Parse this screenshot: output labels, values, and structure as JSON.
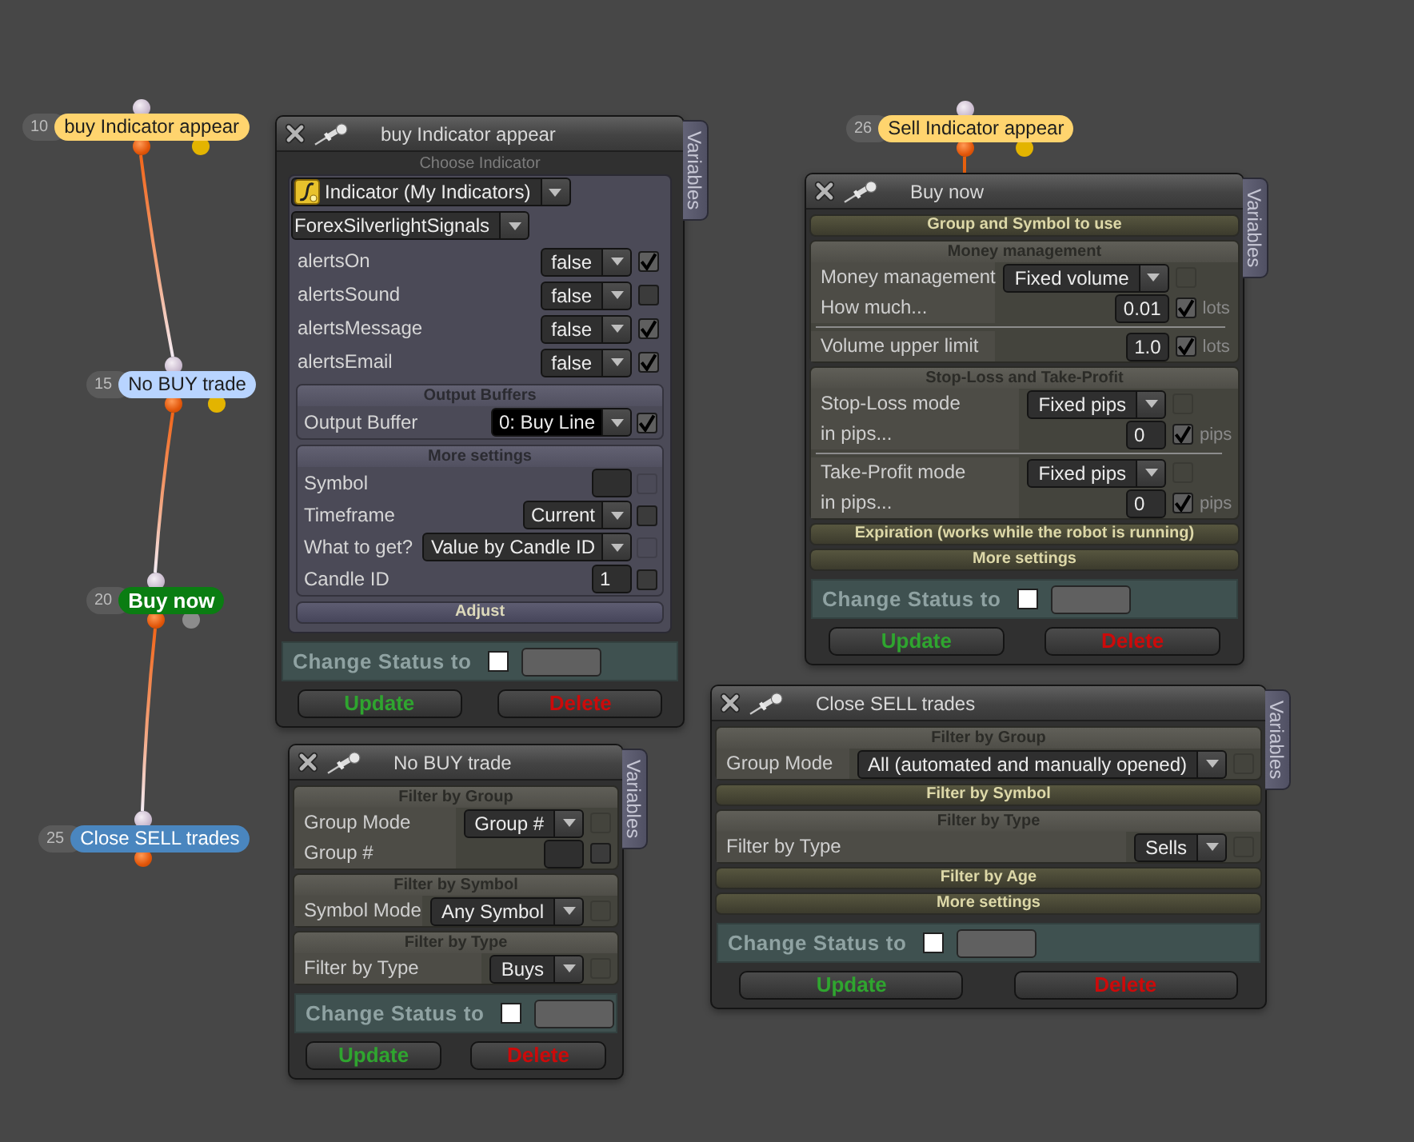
{
  "nodes": [
    {
      "number": "10",
      "label": "buy Indicator appear",
      "color": "#ffd46e",
      "side_pin": {
        "color": "#e3b400"
      },
      "selected": false
    },
    {
      "number": "15",
      "label": "No BUY trade",
      "color": "#b8d4ff",
      "side_pin": {
        "color": "#e3b400"
      },
      "selected": false
    },
    {
      "number": "20",
      "label": "Buy now",
      "color": "#0a7d12",
      "side_pin": {
        "color": "#8c8c8c"
      },
      "selected": true
    },
    {
      "number": "25",
      "label": "Close SELL trades",
      "color": "#4a86bf",
      "selected": false
    },
    {
      "number": "26",
      "label": "Sell Indicator appear",
      "color": "#ffd46e",
      "side_pin": {
        "color": "#e3b400"
      },
      "selected": false
    }
  ],
  "windows": [
    {
      "title": "buy Indicator appear",
      "side_tab": "Variables",
      "blocks": [
        {
          "kind": "caption",
          "text": "Choose Indicator"
        },
        {
          "kind": "panel",
          "rows": [
            {
              "kind": "indicator",
              "value": "Indicator (My Indicators)"
            },
            {
              "kind": "picker",
              "value": "ForexSilverlightSignals"
            },
            {
              "kind": "select",
              "label": "alertsOn",
              "value": "false",
              "focused": false,
              "checkbox": {
                "checked": true,
                "disabled": false
              }
            },
            {
              "kind": "select",
              "label": "alertsSound",
              "value": "false",
              "focused": false,
              "checkbox": {
                "checked": false,
                "disabled": false
              }
            },
            {
              "kind": "select",
              "label": "alertsMessage",
              "value": "false",
              "focused": false,
              "checkbox": {
                "checked": true,
                "disabled": false
              }
            },
            {
              "kind": "select",
              "label": "alertsEmail",
              "value": "false",
              "focused": false,
              "checkbox": {
                "checked": true,
                "disabled": false
              }
            },
            {
              "kind": "section",
              "title": "Output Buffers",
              "expanded": true,
              "rows": [
                {
                  "kind": "select",
                  "label": "Output Buffer",
                  "value": "0: Buy Line",
                  "focused": true,
                  "checkbox": {
                    "checked": true,
                    "disabled": false
                  }
                }
              ]
            },
            {
              "kind": "section",
              "title": "More settings",
              "expanded": true,
              "rows": [
                {
                  "kind": "input",
                  "label": "Symbol",
                  "checkbox": {
                    "checked": false,
                    "disabled": true
                  }
                },
                {
                  "kind": "select",
                  "label": "Timeframe",
                  "value": "Current",
                  "focused": false,
                  "checkbox": {
                    "checked": false,
                    "disabled": false
                  }
                },
                {
                  "kind": "select",
                  "label": "What to get?",
                  "value": "Value by Candle ID",
                  "focused": false,
                  "checkbox": {
                    "checked": false,
                    "disabled": true
                  }
                },
                {
                  "kind": "input",
                  "label": "Candle ID",
                  "value": "1",
                  "checkbox": {
                    "checked": false,
                    "disabled": false
                  }
                }
              ]
            },
            {
              "kind": "section",
              "title": "Adjust",
              "expanded": false
            }
          ]
        }
      ],
      "status": {
        "label": "Change Status to",
        "checked": false
      },
      "buttons": [
        {
          "kind": "update",
          "label": "Update"
        },
        {
          "kind": "delete",
          "label": "Delete"
        }
      ]
    },
    {
      "title": "Buy now",
      "side_tab": "Variables",
      "blocks": [
        {
          "kind": "section",
          "title": "Group and Symbol to use",
          "expanded": false
        },
        {
          "kind": "section",
          "title": "Money management",
          "expanded": true,
          "rows": [
            {
              "kind": "select",
              "label": "Money management",
              "value": "Fixed volume",
              "focused": false,
              "checkbox": {
                "checked": false,
                "disabled": true
              }
            },
            {
              "kind": "input",
              "label": "How much...",
              "value": "0.01",
              "unit": "lots",
              "checkbox": {
                "checked": true,
                "disabled": false
              }
            },
            {
              "kind": "rule"
            },
            {
              "kind": "input",
              "label": "Volume upper limit",
              "value": "1.0",
              "unit": "lots",
              "checkbox": {
                "checked": true,
                "disabled": false
              }
            }
          ]
        },
        {
          "kind": "section",
          "title": "Stop-Loss and Take-Profit",
          "expanded": true,
          "rows": [
            {
              "kind": "select",
              "label": "Stop-Loss mode",
              "value": "Fixed pips",
              "focused": false,
              "checkbox": {
                "checked": false,
                "disabled": true
              }
            },
            {
              "kind": "input",
              "label": "in pips...",
              "value": "0",
              "unit": "pips",
              "checkbox": {
                "checked": true,
                "disabled": false
              }
            },
            {
              "kind": "rule"
            },
            {
              "kind": "select",
              "label": "Take-Profit mode",
              "value": "Fixed pips",
              "focused": false,
              "checkbox": {
                "checked": false,
                "disabled": true
              }
            },
            {
              "kind": "input",
              "label": "in pips...",
              "value": "0",
              "unit": "pips",
              "checkbox": {
                "checked": true,
                "disabled": false
              }
            }
          ]
        },
        {
          "kind": "section",
          "title": "Expiration (works while the robot is running)",
          "expanded": false
        },
        {
          "kind": "section",
          "title": "More settings",
          "expanded": false
        }
      ],
      "status": {
        "label": "Change Status to",
        "checked": false
      },
      "buttons": [
        {
          "kind": "update",
          "label": "Update"
        },
        {
          "kind": "delete",
          "label": "Delete"
        }
      ]
    },
    {
      "title": "No BUY trade",
      "side_tab": "Variables",
      "blocks": [
        {
          "kind": "section",
          "title": "Filter by Group",
          "expanded": true,
          "rows": [
            {
              "kind": "select",
              "label": "Group Mode",
              "value": "Group #",
              "focused": false,
              "checkbox": {
                "checked": false,
                "disabled": true
              }
            },
            {
              "kind": "input",
              "label": "Group #",
              "checkbox": {
                "checked": false,
                "disabled": false
              }
            }
          ]
        },
        {
          "kind": "section",
          "title": "Filter by Symbol",
          "expanded": true,
          "rows": [
            {
              "kind": "select",
              "label": "Symbol Mode",
              "value": "Any Symbol",
              "focused": false,
              "checkbox": {
                "checked": false,
                "disabled": true
              }
            }
          ]
        },
        {
          "kind": "section",
          "title": "Filter by Type",
          "expanded": true,
          "rows": [
            {
              "kind": "select",
              "label": "Filter by Type",
              "value": "Buys",
              "focused": false,
              "checkbox": {
                "checked": false,
                "disabled": true
              }
            }
          ]
        }
      ],
      "status": {
        "label": "Change Status to",
        "checked": false
      },
      "buttons": [
        {
          "kind": "update",
          "label": "Update"
        },
        {
          "kind": "delete",
          "label": "Delete"
        }
      ]
    },
    {
      "title": "Close SELL trades",
      "side_tab": "Variables",
      "blocks": [
        {
          "kind": "section",
          "title": "Filter by Group",
          "expanded": true,
          "rows": [
            {
              "kind": "select",
              "label": "Group Mode",
              "value": "All (automated and manually opened)",
              "focused": false,
              "checkbox": {
                "checked": false,
                "disabled": true
              }
            }
          ]
        },
        {
          "kind": "section",
          "title": "Filter by Symbol",
          "expanded": false
        },
        {
          "kind": "section",
          "title": "Filter by Type",
          "expanded": true,
          "rows": [
            {
              "kind": "select",
              "label": "Filter by Type",
              "value": "Sells",
              "focused": false,
              "checkbox": {
                "checked": false,
                "disabled": true
              }
            }
          ]
        },
        {
          "kind": "section",
          "title": "Filter by Age",
          "expanded": false
        },
        {
          "kind": "section",
          "title": "More settings",
          "expanded": false
        }
      ],
      "status": {
        "label": "Change Status to",
        "checked": false
      },
      "buttons": [
        {
          "kind": "update",
          "label": "Update"
        },
        {
          "kind": "delete",
          "label": "Delete"
        }
      ]
    }
  ]
}
